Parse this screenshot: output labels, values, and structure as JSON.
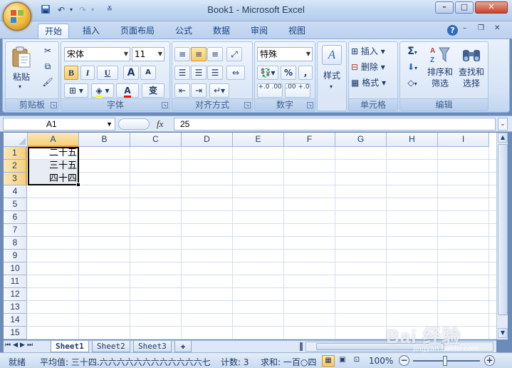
{
  "window": {
    "title": "Book1 - Microsoft Excel"
  },
  "quick_access": {
    "icons": [
      "save-icon",
      "undo-icon",
      "redo-icon",
      "customize-icon"
    ]
  },
  "tabs": [
    "开始",
    "插入",
    "页面布局",
    "公式",
    "数据",
    "审阅",
    "视图"
  ],
  "active_tab": "开始",
  "ribbon": {
    "clipboard": {
      "title": "剪贴板",
      "paste_label": "粘贴"
    },
    "font": {
      "title": "字体",
      "name": "宋体",
      "size": "11",
      "bold": "B",
      "italic": "I",
      "underline": "U",
      "grow": "A",
      "shrink": "A",
      "phonetic": "变",
      "font_color_letter": "A"
    },
    "alignment": {
      "title": "对齐方式"
    },
    "number": {
      "title": "数字",
      "format": "特殊",
      "percent": "%",
      "comma": ",",
      "inc_decimal": "+.0 .00",
      "dec_decimal": ".00 +.0"
    },
    "styles": {
      "label": "样式"
    },
    "cells": {
      "title": "单元格",
      "insert": "插入",
      "delete": "删除",
      "format": "格式"
    },
    "editing": {
      "title": "编辑",
      "sort_filter_line1": "排序和",
      "sort_filter_line2": "筛选",
      "find_select_line1": "查找和",
      "find_select_line2": "选择",
      "sigma": "Σ"
    }
  },
  "formula_bar": {
    "name_box": "A1",
    "fx": "fx",
    "value": "25"
  },
  "sheet": {
    "columns": [
      "A",
      "B",
      "C",
      "D",
      "E",
      "F",
      "G",
      "H",
      "I"
    ],
    "selected_column": "A",
    "rows": [
      "1",
      "2",
      "3",
      "4",
      "5",
      "6",
      "7",
      "8",
      "9",
      "10",
      "11",
      "12",
      "13",
      "14",
      "15"
    ],
    "selected_rows": [
      "1",
      "2",
      "3"
    ],
    "cells": {
      "A1": "二十五",
      "A2": "三十五",
      "A3": "四十四"
    }
  },
  "sheet_tabs": [
    "Sheet1",
    "Sheet2",
    "Sheet3"
  ],
  "active_sheet": "Sheet1",
  "status": {
    "ready": "就绪",
    "average": "平均值: 三十四.六六六六六六六六六六六六七",
    "count": "计数: 3",
    "sum": "求和: 一百○四",
    "zoom": "100%"
  },
  "watermark": {
    "text": "Bai 经验",
    "sub": "jingyan.baidu.com"
  },
  "colors": {
    "accent": "#15428b",
    "selection": "#f6cf7b",
    "ribbon": "#dbe7f7"
  }
}
